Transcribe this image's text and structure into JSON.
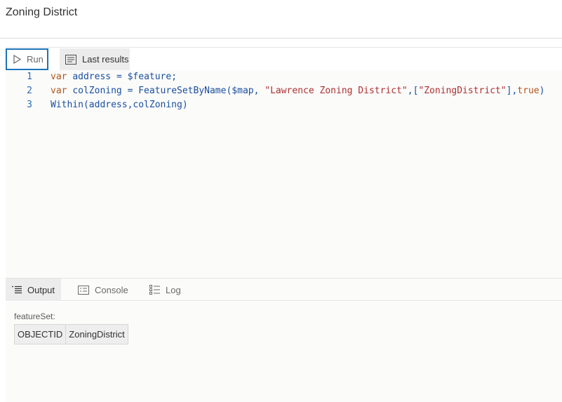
{
  "page": {
    "title": "Zoning District"
  },
  "toolbar": {
    "run_label": "Run",
    "last_results_label": "Last results"
  },
  "editor": {
    "lines": [
      {
        "number": "1",
        "text": "var address = $feature;"
      },
      {
        "number": "2",
        "text": "var colZoning = FeatureSetByName($map, \"Lawrence Zoning District\",[\"ZoningDistrict\"],true)"
      },
      {
        "number": "3",
        "text": "Within(address,colZoning)"
      }
    ]
  },
  "tabs": [
    {
      "label": "Output",
      "icon": "output-list-icon",
      "active": true
    },
    {
      "label": "Console",
      "icon": "console-icon",
      "active": false
    },
    {
      "label": "Log",
      "icon": "log-list-icon",
      "active": false
    }
  ],
  "results": {
    "label": "featureSet:",
    "columns": [
      "OBJECTID",
      "ZoningDistrict"
    ]
  },
  "colors": {
    "accent": "#1d74b7",
    "keyword": "#b4541a",
    "identifier": "#1a4fa0",
    "string": "#b03030"
  }
}
